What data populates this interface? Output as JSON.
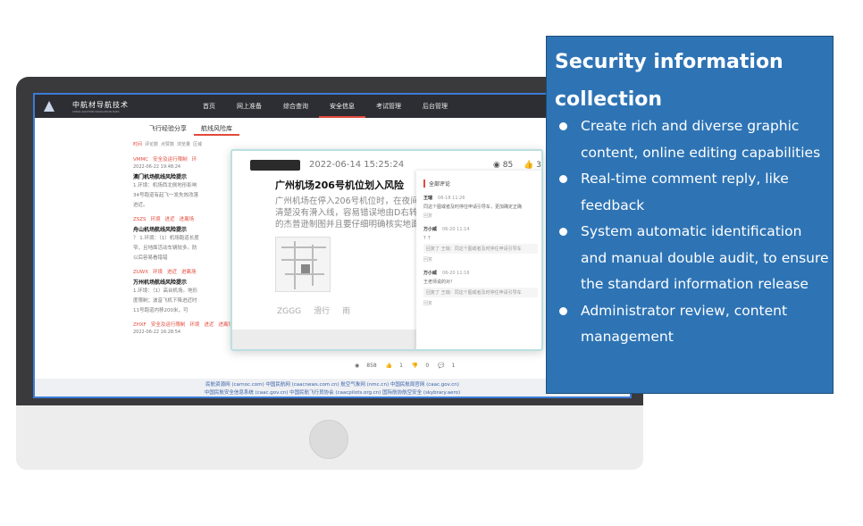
{
  "app": {
    "logo_cn": "中航材导航技术",
    "logo_en": "CHINA AVIATION NAVIGATION DATA",
    "nav": [
      "首页",
      "网上准备",
      "综合查询",
      "安全信息",
      "考试管理",
      "后台管理"
    ],
    "nav_active_index": 3,
    "subtabs": [
      "飞行经验分享",
      "航线风险库"
    ],
    "subtab_active_index": 1,
    "filters": [
      "时间",
      "评论数",
      "点赞数",
      "浏览量",
      "区域"
    ],
    "list": [
      {
        "tags": [
          "VMMC",
          "安全及运行限制",
          "环"
        ],
        "date": "2022-06-22 19:48:24",
        "title": "澳门机场航线风险提示",
        "body": [
          "1.环境：机场西北侧地形影响",
          "34号跑道有起飞一发失效改落",
          "进近。"
        ]
      },
      {
        "tags": [
          "ZSZS",
          "环境",
          "进近",
          "进离场"
        ],
        "date": "",
        "title": "舟山机场航线风险提示",
        "body": [
          "？ 1.环境：（1）机场跑道长度",
          "窄，且地面活动车辆较多。防",
          "以后容易看错错"
        ]
      },
      {
        "tags": [
          "ZUWX",
          "环境",
          "进近",
          "进离场"
        ],
        "date": "",
        "title": "万州机场航线风险提示",
        "body": [
          "1.环境：（1）高台机场。地形",
          "度限制；波音飞机下降进近时",
          "11号跑道内移200米，可"
        ]
      },
      {
        "tags": [
          "ZHXF",
          "安全及运行限制",
          "环境",
          "进近",
          "进离场"
        ],
        "date": "2022-06-22 16:28:54",
        "title": "",
        "body": []
      }
    ],
    "stats": [
      "858",
      "1",
      "0",
      "1"
    ],
    "footer": [
      "民航资源网 (carnoc.com)    中国民航网 (caacnews.com.cn)    航空气象网 (nmc.cn)    中国民航局官网 (caac.gov.cn)",
      "中国民航安全信息系统 (caac.gov.cn)    中国民航飞行员协会 (caacpilots.org.cn)    国际航协航空安全 (skybrary.aero)"
    ]
  },
  "card": {
    "date": "2022-06-14 15:25:24",
    "views": "85",
    "likes": "3",
    "title": "广州机场206号机位划入风险",
    "body": [
      "广州机场在停入206号机位时，在夜间",
      "清楚没有滑入线，容易错误地由D右转",
      "的杰普逊制图并且要仔细明确核实地面"
    ],
    "tags": [
      "ZGGG",
      "滑行",
      "雨"
    ]
  },
  "comments": {
    "header": "全部评论",
    "items": [
      {
        "user": "王瑞",
        "time": "06-18 11:26",
        "text": "同这个图或者及时停住申请引导车，更加确定正确",
        "reply": "",
        "like": "回复"
      },
      {
        "user": "万小威",
        "time": "06-20 11:14",
        "text": "？？",
        "reply": "回复了 王瑞：同这个图或者及时停住申请引导车",
        "like": "回复"
      },
      {
        "user": "万小威",
        "time": "06-20 11:16",
        "text": "王老师说的对！",
        "reply": "回复了 王瑞：同这个图或者及时停住申请引导车",
        "like": "回复"
      }
    ]
  },
  "panel": {
    "title": "Security information collection",
    "bullets": [
      "Create rich and diverse graphic content, online editing capabilities",
      "Real-time comment reply, like feedback",
      "System automatic identification and manual double audit, to ensure the standard information release",
      "Administrator review, content management"
    ]
  },
  "colors": {
    "panel_bg": "#2e74b5",
    "accent_red": "#e24a3b",
    "nav_bg": "#2d2e33"
  }
}
